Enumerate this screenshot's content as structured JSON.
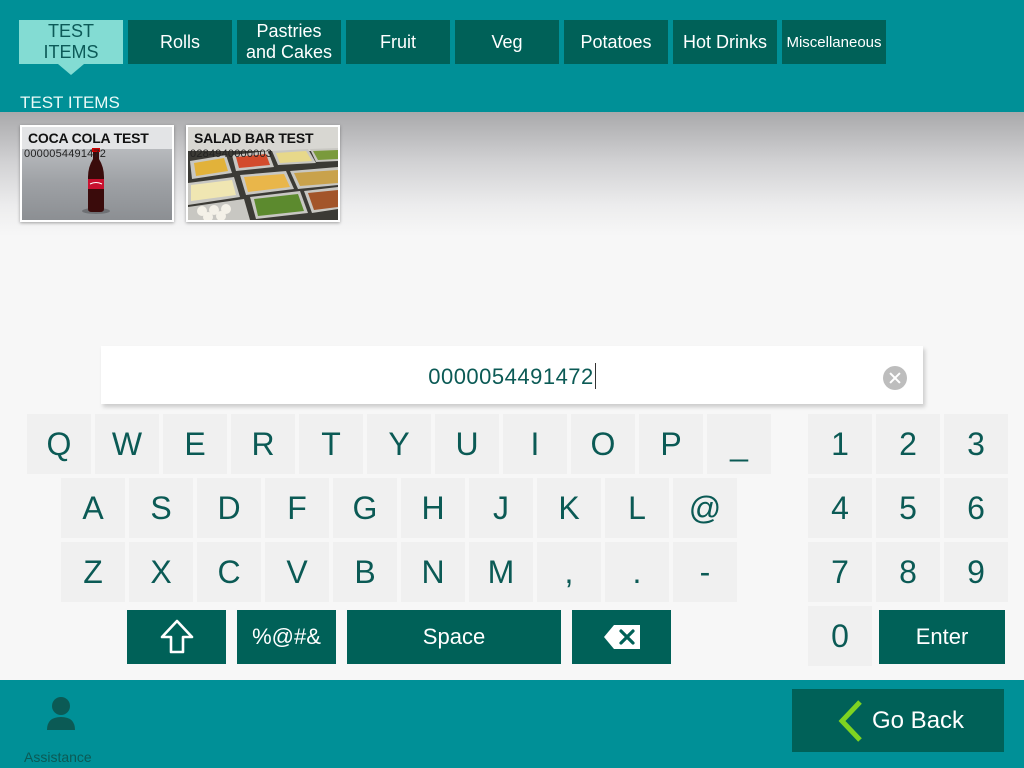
{
  "tabs": [
    {
      "label": "TEST ITEMS",
      "active": true
    },
    {
      "label": "Rolls"
    },
    {
      "label": "Pastries and Cakes"
    },
    {
      "label": "Fruit"
    },
    {
      "label": "Veg"
    },
    {
      "label": "Potatoes"
    },
    {
      "label": "Hot Drinks"
    },
    {
      "label": "Miscellaneous"
    }
  ],
  "category_heading": "TEST ITEMS",
  "products": [
    {
      "name": "COCA COLA TEST",
      "code": "0000054491472",
      "image": "coca-cola-bottle"
    },
    {
      "name": "SALAD BAR TEST",
      "code": "0284940000003",
      "image": "salad-bar"
    }
  ],
  "search": {
    "value": "0000054491472"
  },
  "keyboard": {
    "row1": [
      "Q",
      "W",
      "E",
      "R",
      "T",
      "Y",
      "U",
      "I",
      "O",
      "P",
      "_"
    ],
    "row2": [
      "A",
      "S",
      "D",
      "F",
      "G",
      "H",
      "J",
      "K",
      "L",
      "@"
    ],
    "row3": [
      "Z",
      "X",
      "C",
      "V",
      "B",
      "N",
      "M",
      ",",
      ".",
      "-"
    ],
    "digits": [
      "1",
      "2",
      "3",
      "4",
      "5",
      "6",
      "7",
      "8",
      "9",
      "0"
    ],
    "shift_icon": "shift-arrow-icon",
    "symbols_label": "%@#&",
    "space_label": "Space",
    "backspace_icon": "backspace-icon",
    "enter_label": "Enter"
  },
  "footer": {
    "assistance_label": "Assistance",
    "go_back_label": "Go Back"
  },
  "colors": {
    "header": "#009097",
    "dark_button": "#006158",
    "active_tab": "#83dcd3",
    "key_text": "#0b5a55",
    "accent_green": "#7ed321"
  }
}
